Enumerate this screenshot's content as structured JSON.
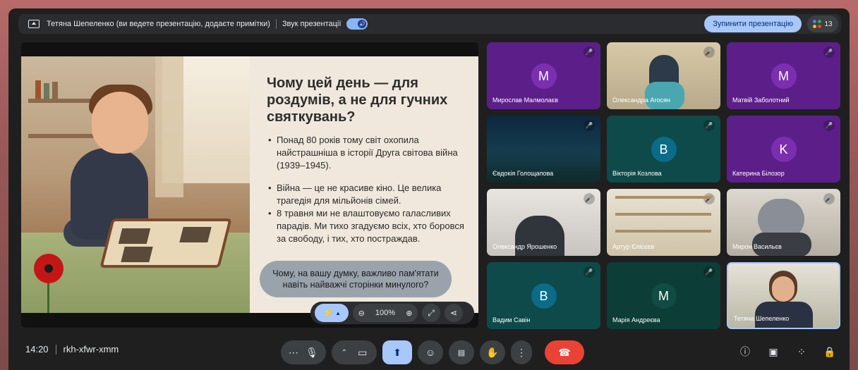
{
  "banner": {
    "presenter_text": "Тетяна Шепеленко (ви ведете презентацію, додаєте примітки)",
    "sound_label": "Звук презентації",
    "stop_button": "Зупинити презентацію",
    "participant_count": "13"
  },
  "slide": {
    "title": "Чому цей день — для роздумів, а не для гучних святкувань?",
    "bullets": [
      "Понад 80 років тому світ охопила найстрашніша в історії Друга світова війна (1939–1945).",
      "Війна — це не красиве кіно. Це велика трагедія для мільйонів сімей.",
      "8 травня ми не влаштовуємо галасливих парадів. Ми тихо згадуємо всіх, хто боровся за свободу, і тих, хто постраждав."
    ],
    "question": "Чому, на вашу думку, важливо пам'ятати навіть найважчі сторінки минулого?"
  },
  "slide_controls": {
    "zoom": "100%"
  },
  "tiles": [
    {
      "name": "Мирослав Малмолаєв",
      "initial": "M"
    },
    {
      "name": "Олександра Агосян",
      "initial": ""
    },
    {
      "name": "Матвій Заболотний",
      "initial": "M"
    },
    {
      "name": "Євдокія Голощапова",
      "initial": ""
    },
    {
      "name": "Вікторія Козлова",
      "initial": "B"
    },
    {
      "name": "Катерина Білозор",
      "initial": "K"
    },
    {
      "name": "Олександр Ярошенко",
      "initial": ""
    },
    {
      "name": "Артур Єлісєєв",
      "initial": ""
    },
    {
      "name": "Мирон Васильєв",
      "initial": ""
    },
    {
      "name": "Вадим Савін",
      "initial": "B"
    },
    {
      "name": "Марія Андреєва",
      "initial": "M"
    },
    {
      "name": "Тетяна Шепеленко",
      "initial": ""
    }
  ],
  "meeting": {
    "time": "14:20",
    "code": "rkh-xfwr-xmm"
  },
  "colors": {
    "accent": "#a8c7fa",
    "end_call": "#ea4335",
    "purple_tile": "#5c1f8a",
    "teal_tile": "#0e4a49"
  }
}
